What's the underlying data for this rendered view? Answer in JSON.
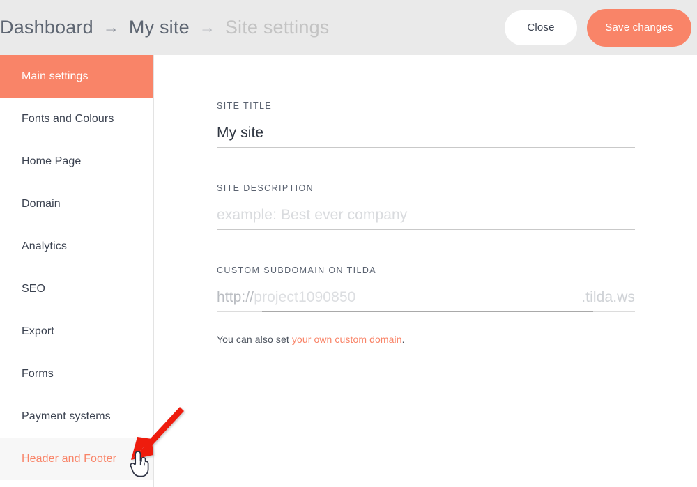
{
  "header": {
    "breadcrumb": {
      "root": "Dashboard",
      "separator": "→",
      "site": "My site",
      "current": "Site settings"
    },
    "buttons": {
      "close": "Close",
      "save": "Save changes"
    }
  },
  "sidebar": {
    "items": [
      {
        "label": "Main settings",
        "state": "active"
      },
      {
        "label": "Fonts and Colours",
        "state": "default"
      },
      {
        "label": "Home Page",
        "state": "default"
      },
      {
        "label": "Domain",
        "state": "default"
      },
      {
        "label": "Analytics",
        "state": "default"
      },
      {
        "label": "SEO",
        "state": "default"
      },
      {
        "label": "Export",
        "state": "default"
      },
      {
        "label": "Forms",
        "state": "default"
      },
      {
        "label": "Payment systems",
        "state": "default"
      },
      {
        "label": "Header and Footer",
        "state": "hovered"
      }
    ]
  },
  "main": {
    "fields": {
      "site_title": {
        "label": "SITE TITLE",
        "value": "My site",
        "placeholder": "My site"
      },
      "site_description": {
        "label": "SITE DESCRIPTION",
        "value": "",
        "placeholder": "example: Best ever company"
      },
      "custom_subdomain": {
        "label": "CUSTOM SUBDOMAIN ON TILDA",
        "protocol": "http://",
        "value": "",
        "placeholder": "project1090850",
        "suffix": ".tilda.ws"
      }
    },
    "help": {
      "text": "You can also set ",
      "link": "your own custom domain",
      "period": "."
    }
  },
  "annotation": {
    "arrow_color": "#ee1b11",
    "cursor": "pointer-hand-cursor"
  },
  "colors": {
    "accent": "#f98468",
    "header_bg": "#eaeaea",
    "text_dark": "#3b4250",
    "text_muted": "#c3c3c3",
    "hover_bg": "#f7f7f7"
  }
}
